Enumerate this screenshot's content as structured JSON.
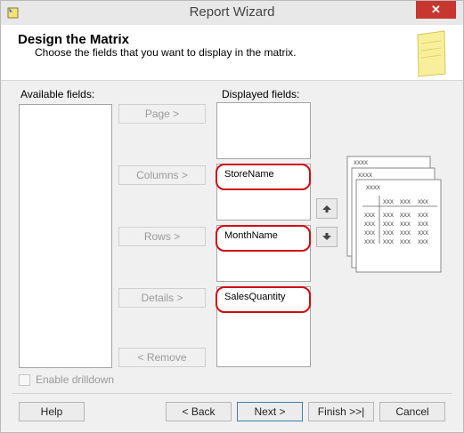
{
  "window": {
    "title": "Report Wizard",
    "close_glyph": "✕"
  },
  "header": {
    "title": "Design the Matrix",
    "subtitle": "Choose the fields that you want to display in the matrix."
  },
  "labels": {
    "available": "Available fields:",
    "displayed": "Displayed fields:"
  },
  "buttons": {
    "page": "Page >",
    "columns": "Columns >",
    "rows": "Rows >",
    "details": "Details >",
    "remove": "< Remove"
  },
  "fields": {
    "columns": "StoreName",
    "rows": "MonthName",
    "details": "SalesQuantity"
  },
  "drilldown": {
    "label": "Enable drilldown",
    "checked": false
  },
  "preview": {
    "header_text": "xxxx",
    "cell_text": "xxx"
  },
  "footer": {
    "help": "Help",
    "back": "< Back",
    "next": "Next >",
    "finish": "Finish >>|",
    "cancel": "Cancel"
  },
  "colors": {
    "highlight": "#d00b14",
    "close": "#c7372f"
  }
}
